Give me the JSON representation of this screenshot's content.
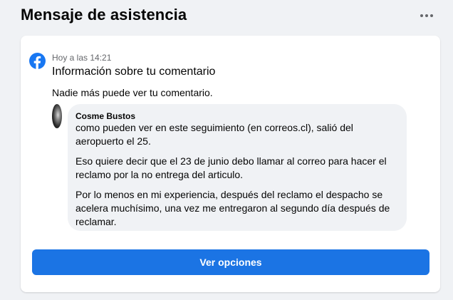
{
  "page": {
    "title": "Mensaje de asistencia",
    "more_icon": "more-horizontal-icon"
  },
  "notice": {
    "icon": "facebook-logo-icon",
    "brand_color": "#1877f2",
    "timestamp": "Hoy a las 14:21",
    "title": "Información sobre tu comentario",
    "privacy_note": "Nadie más puede ver tu comentario."
  },
  "comment": {
    "author": "Cosme Bustos",
    "paragraphs": [
      "como pueden ver en este seguimiento (en correos.cl), salió del aeropuerto el 25.",
      "Eso quiere decir que el 23 de junio debo llamar al correo para hacer el reclamo por la no entrega del articulo.",
      "Por lo menos en mi experiencia, después del reclamo el despacho se acelera muchísimo, una vez me entregaron al segundo día después de reclamar."
    ]
  },
  "actions": {
    "primary_label": "Ver opciones",
    "primary_color": "#1b74e4"
  }
}
